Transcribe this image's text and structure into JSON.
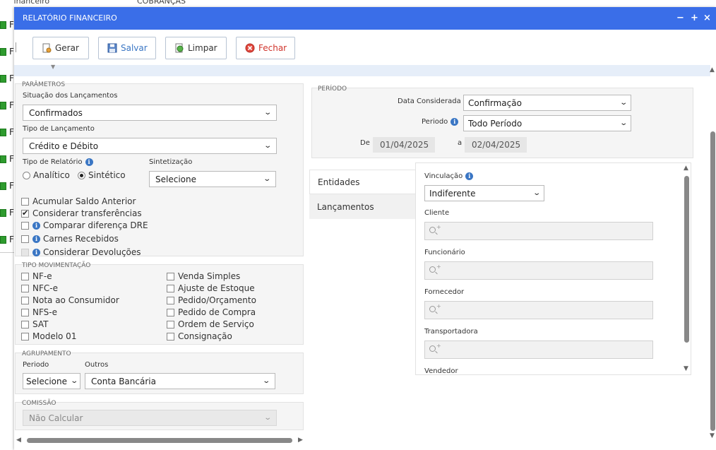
{
  "background": {
    "top_items": [
      "Financeiro",
      "COBRANÇAS"
    ],
    "row_letter": "F",
    "row_count": 9
  },
  "dialog": {
    "title": "RELATÓRIO FINANCEIRO",
    "controls": {
      "minimize": "−",
      "maximize": "+",
      "close": "×"
    }
  },
  "toolbar": {
    "gerar": "Gerar",
    "salvar": "Salvar",
    "limpar": "Limpar",
    "fechar": "Fechar"
  },
  "parametros": {
    "legend": "PARÂMETROS",
    "situacao_label": "Situação dos Lançamentos",
    "situacao_value": "Confirmados",
    "tipo_lancamento_label": "Tipo de Lançamento",
    "tipo_lancamento_value": "Crédito e Débito",
    "tipo_relatorio_label": "Tipo de Relatório",
    "tipo_relatorio_options": [
      "Analítico",
      "Sintético"
    ],
    "tipo_relatorio_selected": "Sintético",
    "sintetizacao_label": "Sintetização",
    "sintetizacao_value": "Selecione",
    "checkboxes": [
      {
        "label": "Acumular Saldo Anterior",
        "checked": false
      },
      {
        "label": "Considerar transferências",
        "checked": true
      },
      {
        "label": "Comparar diferença DRE",
        "checked": false
      },
      {
        "label": "Carnes Recebidos",
        "checked": false
      },
      {
        "label": "Considerar Devoluções",
        "checked": false
      }
    ]
  },
  "tipo_movimentacao": {
    "legend": "TIPO MOVIMENTAÇÃO",
    "left": [
      "NF-e",
      "NFC-e",
      "Nota ao Consumidor",
      "NFS-e",
      "SAT",
      "Modelo 01"
    ],
    "right": [
      "Venda Simples",
      "Ajuste de Estoque",
      "Pedido/Orçamento",
      "Pedido de Compra",
      "Ordem de Serviço",
      "Consignação"
    ]
  },
  "agrupamento": {
    "legend": "AGRUPAMENTO",
    "periodo_label": "Periodo",
    "periodo_value": "Selecione",
    "outros_label": "Outros",
    "outros_value": "Conta Bancária"
  },
  "comissao": {
    "legend": "COMISSÃO",
    "value": "Não Calcular"
  },
  "periodo": {
    "legend": "PERÍODO",
    "data_considerada_label": "Data Considerada",
    "data_considerada_value": "Confirmação",
    "periodo_label": "Periodo",
    "periodo_value": "Todo Período",
    "de_label": "De",
    "de_value": "01/04/2025",
    "a_label": "a",
    "a_value": "02/04/2025"
  },
  "tabs": [
    "Entidades",
    "Lançamentos"
  ],
  "entidades": {
    "vinculacao_label": "Vinculação",
    "vinculacao_value": "Indiferente",
    "fields": [
      "Cliente",
      "Funcionário",
      "Fornecedor",
      "Transportadora",
      "Vendedor"
    ]
  }
}
